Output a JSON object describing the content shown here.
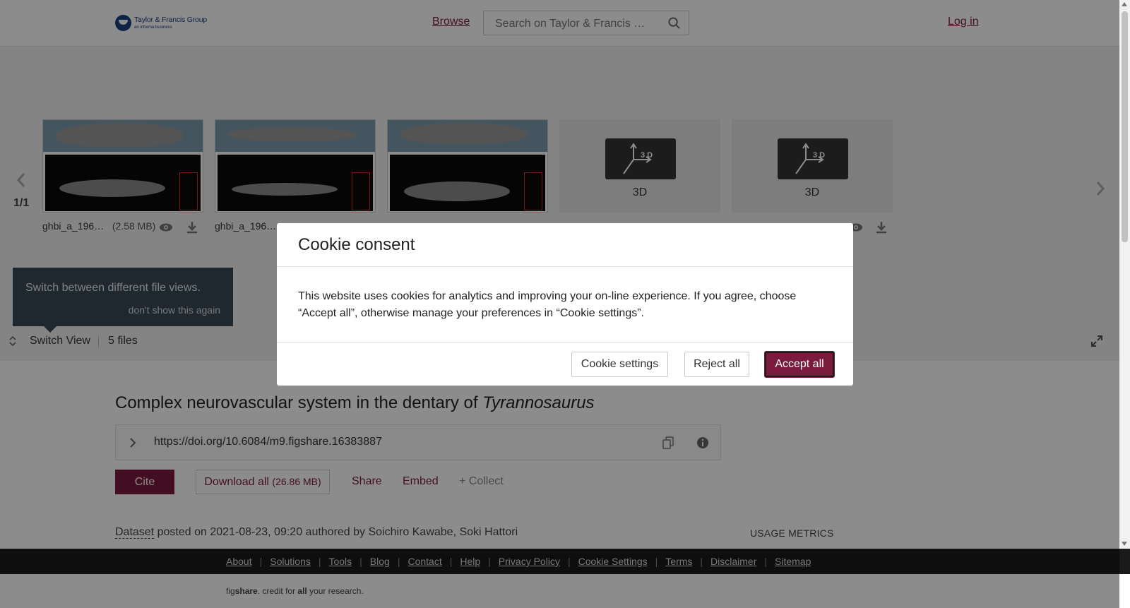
{
  "header": {
    "logo_name": "Taylor & Francis Group",
    "logo_sub": "an informa business",
    "browse": "Browse",
    "search_placeholder": "Search on Taylor & Francis …",
    "login": "Log in"
  },
  "viewer": {
    "pager": "1/1",
    "files": [
      {
        "name": "ghbi_a_196…",
        "size": "(2.58 MB)"
      },
      {
        "name": "ghbi_a_196…",
        "size": ""
      },
      {
        "name": "",
        "size": ""
      },
      {
        "name": "",
        "size": "",
        "label": "3D"
      },
      {
        "name": "",
        "size": "",
        "label": "3D"
      }
    ],
    "badge_3d": "3 D",
    "tooltip_text": "Switch between different file views.",
    "tooltip_dismiss": "don't show this again",
    "switch_view": "Switch View",
    "files_count": "5 files"
  },
  "item": {
    "title_plain": "Complex neurovascular system in the dentary of ",
    "title_italic": "Tyrannosaurus",
    "doi": "https://doi.org/10.6084/m9.figshare.16383887",
    "cite": "Cite",
    "download_all": "Download all",
    "download_size": "(26.86 MB)",
    "share": "Share",
    "embed": "Embed",
    "collect": "+ Collect",
    "dataset_type": "Dataset",
    "posted": "posted on 2021-08-23, 09:20 authored by Soichiro Kawabe, Soki Hattori",
    "usage_metrics": "USAGE METRICS"
  },
  "footer": {
    "links": [
      "About",
      "Solutions",
      "Tools",
      "Blog",
      "Contact",
      "Help",
      "Privacy Policy",
      "Cookie Settings",
      "Terms",
      "Disclaimer",
      "Sitemap"
    ],
    "tagline_pre": "fig",
    "tagline_brand": "share",
    "tagline_mid": ". credit for ",
    "tagline_all": "all",
    "tagline_post": " your research."
  },
  "cookie": {
    "title": "Cookie consent",
    "body": "This website uses cookies for analytics and improving your on-line experience. If you agree, choose “Accept all”, otherwise manage your preferences in “Cookie settings”.",
    "settings": "Cookie settings",
    "reject": "Reject all",
    "accept": "Accept all"
  },
  "colors": {
    "brand": "#7a1a3c",
    "footer_bg": "#1a1a1a",
    "tooltip_bg": "#3b4a57"
  }
}
